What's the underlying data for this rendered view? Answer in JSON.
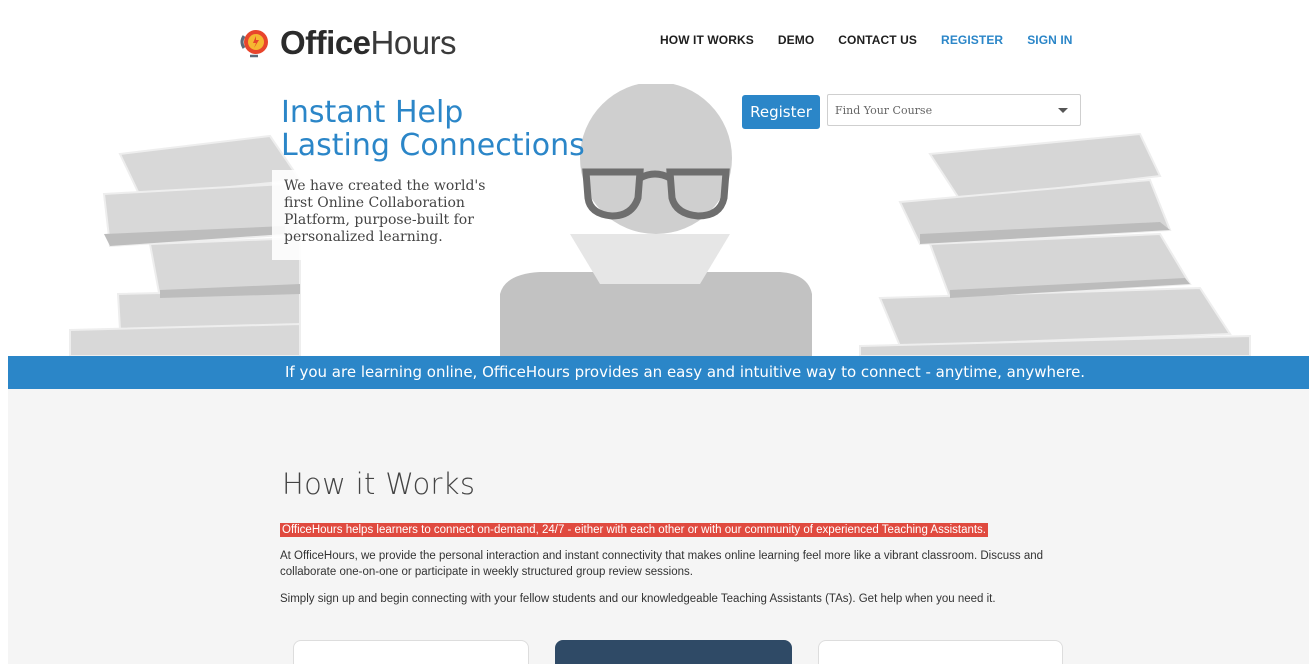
{
  "header": {
    "logo_bold": "Office",
    "logo_light": "Hours",
    "nav": [
      {
        "label": "HOW IT WORKS"
      },
      {
        "label": "DEMO"
      },
      {
        "label": "CONTACT US"
      },
      {
        "label": "REGISTER"
      },
      {
        "label": "SIGN IN"
      }
    ]
  },
  "hero": {
    "title_line1": "Instant Help",
    "title_line2": "Lasting Connections",
    "copy": "We have created the world's first Online Collaboration Platform, purpose-built for personalized learning.",
    "register_label": "Register",
    "course_placeholder": "Find Your Course"
  },
  "band": {
    "text": "If you are learning online, OfficeHours provides an easy and intuitive way to connect - anytime, anywhere."
  },
  "how_it_works": {
    "title": "How it Works",
    "highlight": "OfficeHours helps learners to connect on-demand, 24/7 - either with each other or with our community of experienced Teaching Assistants.",
    "paragraph1": "At OfficeHours, we provide the personal interaction and instant connectivity that makes online learning feel more like a vibrant classroom. Discuss and collaborate one-on-one or participate in weekly structured group review sessions.",
    "paragraph2": "Simply sign up and begin connecting with your fellow students and our knowledgeable Teaching Assistants (TAs). Get help when you need it."
  },
  "colors": {
    "brand_blue": "#2b86c8",
    "highlight_red": "#e04a3f",
    "logo_orange": "#e8452c"
  },
  "icons": [
    "logo-icon",
    "chevron-down-icon"
  ]
}
